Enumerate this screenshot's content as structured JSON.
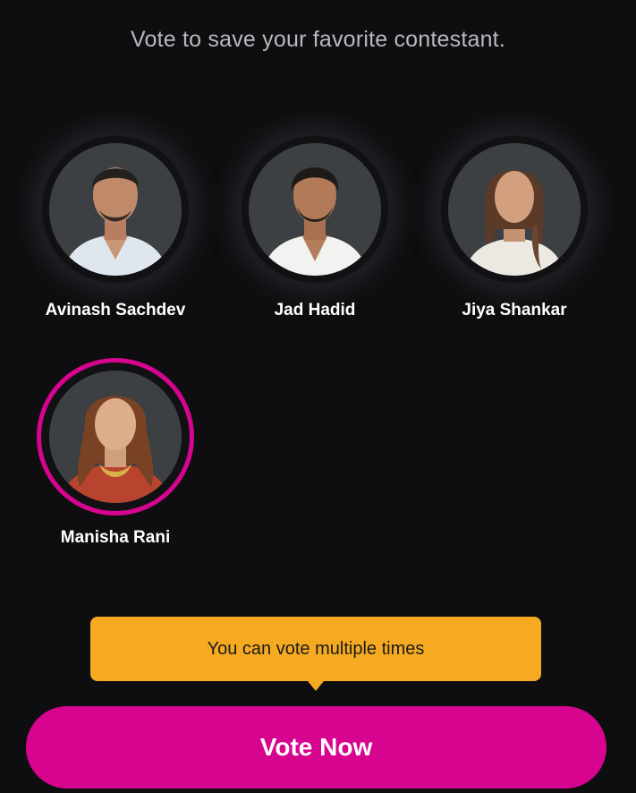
{
  "header": {
    "subtitle": "Vote to save your favorite contestant."
  },
  "contestants": [
    {
      "name": "Avinash Sachdev",
      "selected": false,
      "outfit": "#dfe6ee"
    },
    {
      "name": "Jad Hadid",
      "selected": false,
      "outfit": "#f2f2f0"
    },
    {
      "name": "Jiya Shankar",
      "selected": false,
      "outfit": "#ece8e2"
    },
    {
      "name": "Manisha Rani",
      "selected": true,
      "outfit": "#b8432f"
    }
  ],
  "tooltip": {
    "text": "You can vote multiple times"
  },
  "vote_button": {
    "label": "Vote Now"
  },
  "colors": {
    "background": "#0e0e10",
    "accent": "#d7048f",
    "tooltip_bg": "#f6aa22",
    "avatar_bg": "#3c4043"
  }
}
